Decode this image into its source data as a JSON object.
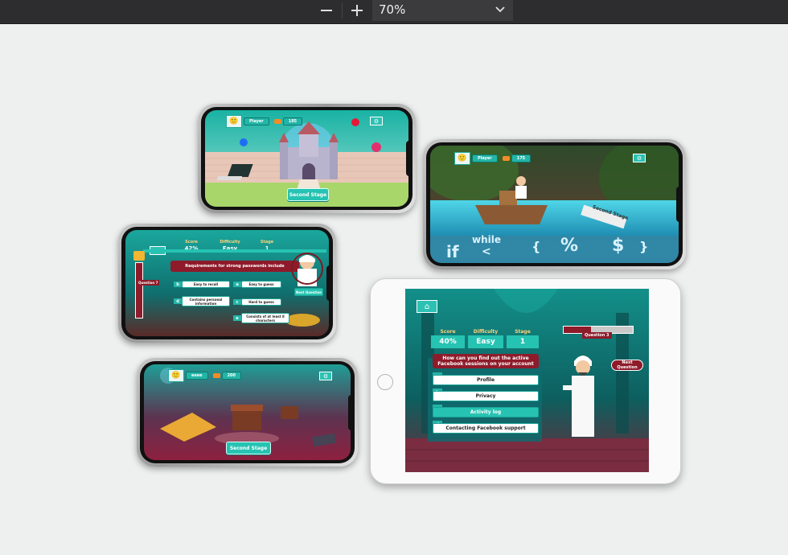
{
  "toolbar": {
    "zoom_out_icon": "minus-icon",
    "zoom_in_icon": "plus-icon",
    "zoom_value": "70%",
    "dropdown_icon": "chevron-down-icon"
  },
  "colors": {
    "toolbar": "#2d2d2f",
    "canvas": "#eef0ef",
    "accent": "#23b5a7",
    "question_red": "#8e1b2a"
  },
  "screen_castle": {
    "player_label": "Player",
    "coins": "185",
    "stage_button": "Second Stage"
  },
  "screen_boat": {
    "player_label": "Player",
    "coins": "175",
    "sign_text": "Second Stage",
    "code_symbols": [
      "if",
      "while",
      "<",
      "{",
      "%",
      "$",
      "}"
    ]
  },
  "screen_quiz_phone": {
    "score_label": "Score",
    "score_value": "42%",
    "difficulty_label": "Difficulty",
    "difficulty_value": "Easy",
    "stage_label": "Stage",
    "stage_value": "1",
    "question_counter": "Question 7",
    "question": "Requirements for strong passwords include",
    "answers": [
      {
        "letter": "b",
        "text": "Easy to recall"
      },
      {
        "letter": "a",
        "text": "Easy to guess"
      },
      {
        "letter": "d",
        "text": "Contains personal information"
      },
      {
        "letter": "c",
        "text": "Hard to guess"
      },
      {
        "letter": "e",
        "text": "Consists of at least 8 characters"
      }
    ],
    "next_button": "Next Question"
  },
  "screen_treasure": {
    "player_name": "eeee",
    "coins": "200",
    "stage_button": "Second Stage"
  },
  "screen_tablet": {
    "score_label": "Score",
    "score_value": "40%",
    "difficulty_label": "Difficulty",
    "difficulty_value": "Easy",
    "stage_label": "Stage",
    "stage_value": "1",
    "question_counter": "Question 3",
    "question": "How can you find out the active Facebook sessions on your account",
    "answers": [
      {
        "letter": "a",
        "text": "Profile"
      },
      {
        "letter": "b",
        "text": "Privacy"
      },
      {
        "letter": "c",
        "text": "Activity log"
      },
      {
        "letter": "d",
        "text": "Contacting Facebook support"
      }
    ],
    "next_button": "Next Question"
  }
}
